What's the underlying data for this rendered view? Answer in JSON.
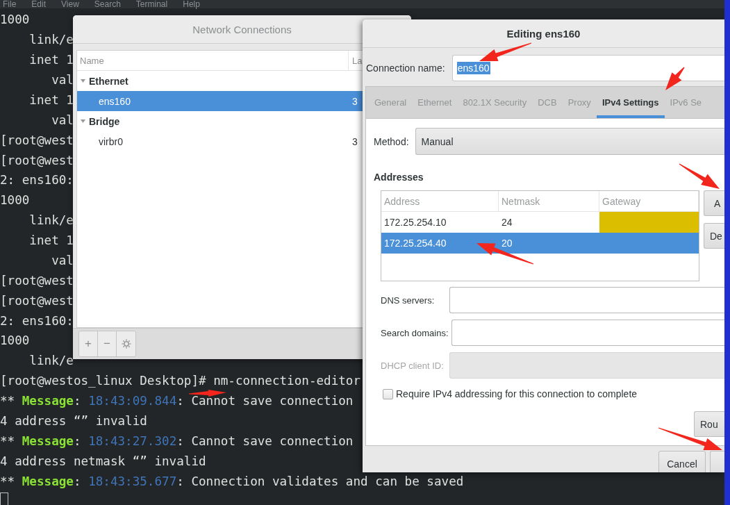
{
  "terminal": {
    "menu": [
      "File",
      "Edit",
      "View",
      "Search",
      "Terminal",
      "Help"
    ],
    "lines": [
      [
        {
          "kind": "plain",
          "text": "1000"
        }
      ],
      [
        {
          "kind": "plain",
          "text": "    link/e"
        }
      ],
      [
        {
          "kind": "plain",
          "text": "    inet 1"
        }
      ],
      [
        {
          "kind": "plain",
          "text": "       val"
        }
      ],
      [
        {
          "kind": "plain",
          "text": "    inet 1"
        }
      ],
      [
        {
          "kind": "plain",
          "text": "       val"
        }
      ],
      [
        {
          "kind": "plain",
          "text": "[root@west"
        }
      ],
      [
        {
          "kind": "plain",
          "text": "[root@west"
        }
      ],
      [
        {
          "kind": "plain",
          "text": "2: ens160:"
        }
      ],
      [
        {
          "kind": "plain",
          "text": "1000"
        }
      ],
      [
        {
          "kind": "plain",
          "text": "    link/e"
        }
      ],
      [
        {
          "kind": "plain",
          "text": "    inet 1"
        }
      ],
      [
        {
          "kind": "plain",
          "text": "       val"
        }
      ],
      [
        {
          "kind": "plain",
          "text": "[root@west"
        }
      ],
      [
        {
          "kind": "plain",
          "text": "[root@west"
        }
      ],
      [
        {
          "kind": "plain",
          "text": "2: ens160:"
        }
      ],
      [
        {
          "kind": "plain",
          "text": "1000"
        }
      ],
      [
        {
          "kind": "plain",
          "text": "    link/e"
        }
      ],
      [
        {
          "kind": "plain",
          "text": "[root@westos_linux Desktop]# nm-connection-editor"
        }
      ],
      [
        {
          "kind": "plain",
          "text": "** "
        },
        {
          "kind": "keyword",
          "text": "Message"
        },
        {
          "kind": "plain",
          "text": ": "
        },
        {
          "kind": "time",
          "text": "18:43:09.844"
        },
        {
          "kind": "plain",
          "text": ": Cannot save connection"
        }
      ],
      [
        {
          "kind": "plain",
          "text": "4 address “” invalid"
        }
      ],
      [
        {
          "kind": "plain",
          "text": "** "
        },
        {
          "kind": "keyword",
          "text": "Message"
        },
        {
          "kind": "plain",
          "text": ": "
        },
        {
          "kind": "time",
          "text": "18:43:27.302"
        },
        {
          "kind": "plain",
          "text": ": Cannot save connection"
        }
      ],
      [
        {
          "kind": "plain",
          "text": "4 address netmask “” invalid"
        }
      ],
      [
        {
          "kind": "plain",
          "text": "** "
        },
        {
          "kind": "keyword",
          "text": "Message"
        },
        {
          "kind": "plain",
          "text": ": "
        },
        {
          "kind": "time",
          "text": "18:43:35.677"
        },
        {
          "kind": "plain",
          "text": ": Connection validates and can be saved"
        }
      ]
    ]
  },
  "connections": {
    "title": "Network Connections",
    "columns": [
      "Name",
      "La"
    ],
    "groups": [
      {
        "label": "Ethernet",
        "expanded": true,
        "children": [
          {
            "name": "ens160",
            "column_2": "3",
            "selected": true
          }
        ]
      },
      {
        "label": "Bridge",
        "expanded": true,
        "children": [
          {
            "name": "virbr0",
            "column_2": "3",
            "selected": false
          }
        ]
      }
    ],
    "toolbar": [
      "+",
      "−"
    ]
  },
  "editor": {
    "title": "Editing ens160",
    "connection_label": "Connection name:",
    "connection_name": "ens160",
    "name_selected": true,
    "tabs": [
      {
        "label": "General",
        "selected": false
      },
      {
        "label": "Ethernet",
        "selected": false
      },
      {
        "label": "802.1X Security",
        "selected": false
      },
      {
        "label": "DCB",
        "selected": false
      },
      {
        "label": "Proxy",
        "selected": false
      },
      {
        "label": "IPv4 Settings",
        "selected": true
      },
      {
        "label": "IPv6 Se",
        "selected": false
      }
    ],
    "method_label": "Method:",
    "method": "Manual",
    "addresses_heading": "Addresses",
    "address_columns": [
      "Address",
      "Netmask",
      "Gateway"
    ],
    "addresses": [
      {
        "address": "172.25.254.10",
        "netmask": "24",
        "gateway_highlight": true,
        "selected": false
      },
      {
        "address": "172.25.254.40",
        "netmask": "20",
        "gateway_highlight": false,
        "selected": true
      }
    ],
    "address_buttons": [
      "A",
      "De"
    ],
    "fields": [
      {
        "label": "DNS servers:",
        "disabled": false
      },
      {
        "label": "Search domains:",
        "disabled": false
      },
      {
        "label": "DHCP client ID:",
        "disabled": true
      }
    ],
    "require": {
      "label": "Require IPv4 addressing for this connection to complete",
      "checked": false
    },
    "routes_button": "Rou",
    "buttons": [
      {
        "kind": "text",
        "label": "Cancel"
      },
      {
        "kind": "blank"
      }
    ]
  }
}
